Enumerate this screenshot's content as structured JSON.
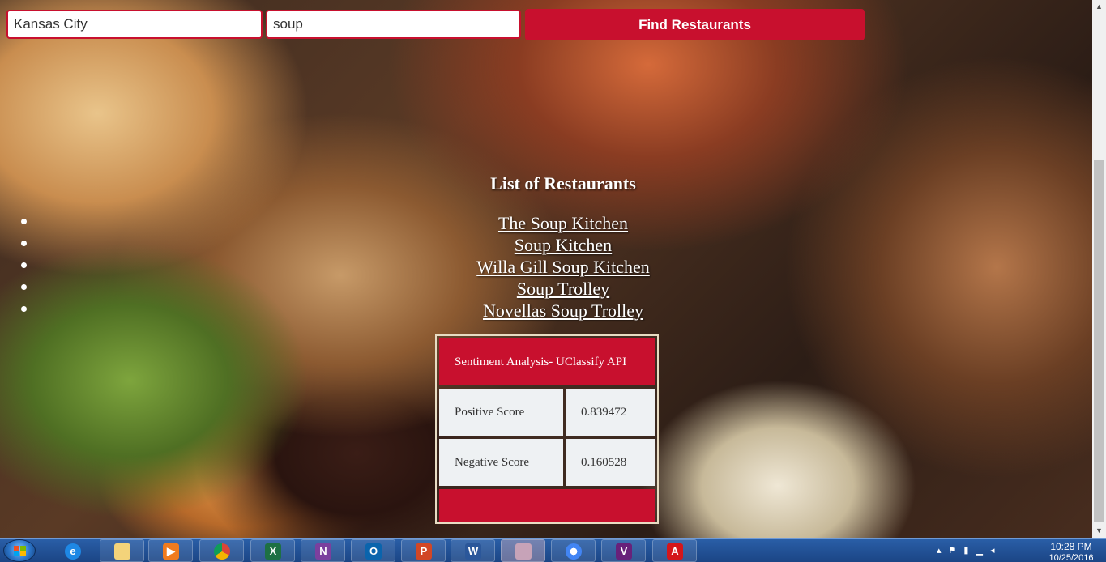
{
  "search": {
    "location_value": "Kansas City",
    "query_value": "soup",
    "button_label": "Find Restaurants"
  },
  "list": {
    "title": "List of Restaurants",
    "restaurants": [
      "The Soup Kitchen",
      "Soup Kitchen",
      "Willa Gill Soup Kitchen",
      "Soup Trolley",
      "Novellas Soup Trolley"
    ]
  },
  "sentiment": {
    "header": "Sentiment Analysis- UClassify API",
    "positive_label": "Positive Score",
    "positive_value": "0.839472",
    "negative_label": "Negative Score",
    "negative_value": "0.160528"
  },
  "colors": {
    "accent": "#c8102e",
    "taskbar": "#1b4585"
  },
  "taskbar": {
    "apps": [
      {
        "name": "internet-explorer-icon",
        "glyph": "e"
      },
      {
        "name": "file-explorer-icon",
        "glyph": ""
      },
      {
        "name": "media-player-icon",
        "glyph": "▶"
      },
      {
        "name": "chrome-icon",
        "glyph": ""
      },
      {
        "name": "excel-icon",
        "glyph": "X"
      },
      {
        "name": "onenote-icon",
        "glyph": "N"
      },
      {
        "name": "outlook-icon",
        "glyph": "O"
      },
      {
        "name": "powerpoint-icon",
        "glyph": "P"
      },
      {
        "name": "word-icon",
        "glyph": "W"
      },
      {
        "name": "paint-icon",
        "glyph": ""
      },
      {
        "name": "chrome-canary-icon",
        "glyph": ""
      },
      {
        "name": "visual-studio-icon",
        "glyph": "V"
      },
      {
        "name": "acrobat-icon",
        "glyph": "A"
      }
    ],
    "clock_time": "10:28 PM",
    "clock_date": "10/25/2016"
  }
}
